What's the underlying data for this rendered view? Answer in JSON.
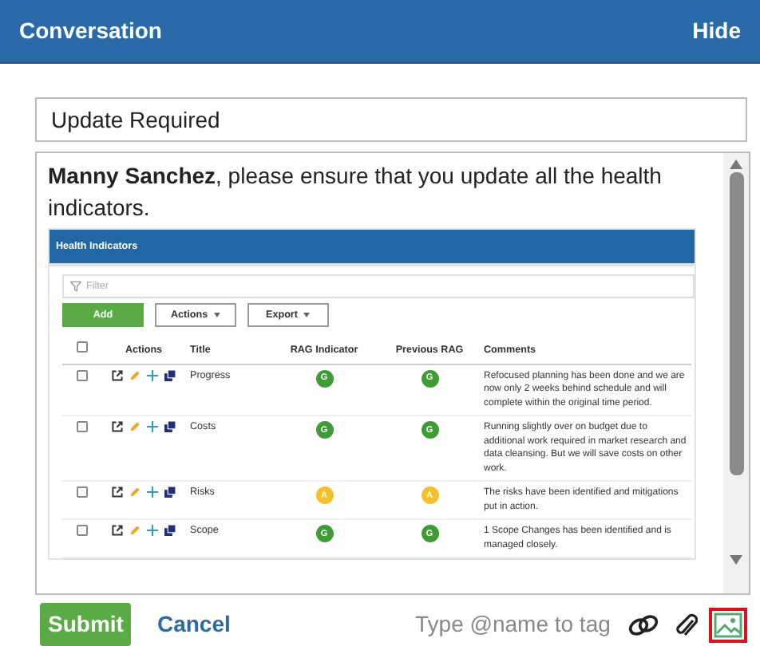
{
  "panel": {
    "title": "Conversation",
    "hide_label": "Hide"
  },
  "subject": {
    "value": "Update Required"
  },
  "message": {
    "text": "**Manny Sanchez**, please ensure that you update all the health indicators.",
    "embedded": {
      "title": "Health Indicators",
      "filter_placeholder": "Filter",
      "buttons": [
        {
          "label": "Add",
          "kind": "primary"
        },
        {
          "label": "Actions",
          "kind": "dropdown"
        },
        {
          "label": "Export",
          "kind": "dropdown"
        }
      ],
      "header_checked": false,
      "columns": [
        "Actions",
        "Title",
        "RAG Indicator",
        "Previous RAG",
        "Comments"
      ],
      "rows": [
        {
          "checked": false,
          "title": "Progress",
          "rag": {
            "label": "G",
            "color": "#3f9c35"
          },
          "previous_rag": {
            "label": "G",
            "color": "#3f9c35"
          },
          "comments": "Refocused planning has been done and we are now only 2 weeks behind schedule and will complete within the original time period."
        },
        {
          "checked": false,
          "title": "Costs",
          "rag": {
            "label": "G",
            "color": "#3f9c35"
          },
          "previous_rag": {
            "label": "G",
            "color": "#3f9c35"
          },
          "comments": "Running slightly over on budget due to additional work required in market research and data cleansing. But we will save costs on other work."
        },
        {
          "checked": false,
          "title": "Risks",
          "rag": {
            "label": "A",
            "color": "#f5c02a"
          },
          "previous_rag": {
            "label": "A",
            "color": "#f5c02a"
          },
          "comments": "The risks have been identified and mitigations put in action."
        },
        {
          "checked": false,
          "title": "Scope",
          "rag": {
            "label": "G",
            "color": "#3f9c35"
          },
          "previous_rag": {
            "label": "G",
            "color": "#3f9c35"
          },
          "comments": "1 Scope Changes has been identified and is managed closely."
        }
      ]
    }
  },
  "footer": {
    "submit": "Submit",
    "cancel": "Cancel",
    "tag_placeholder": "Type @name to tag",
    "tools": [
      {
        "kind": "link",
        "highlighted": false
      },
      {
        "kind": "attach",
        "highlighted": false
      },
      {
        "kind": "image",
        "highlighted": true
      }
    ]
  }
}
